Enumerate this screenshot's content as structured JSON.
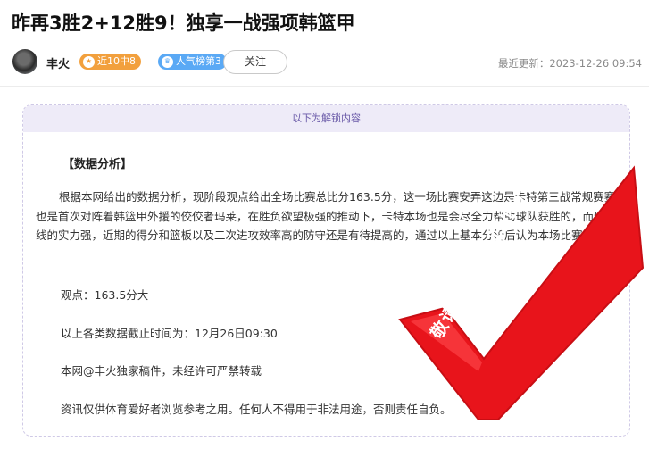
{
  "article": {
    "title": "昨再3胜2+12胜9！独享一战强项韩篮甲"
  },
  "meta": {
    "author": "丰火",
    "badge_streak": "近10中8",
    "badge_rank": "人气榜第3",
    "follow_label": "关注",
    "update_time": "最近更新：2023-12-26 09:54"
  },
  "content": {
    "unlock_header": "以下为解锁内容",
    "section_title": "【数据分析】",
    "paragraph": "根据本网给出的数据分析，现阶段观点给出全场比赛总比分163.5分，这一场比赛安弄这边是卡特第三战常规赛赛事，也是首次对阵着韩篮甲外援的佼佼者玛莱，在胜负欲望极强的推动下，卡特本场也是会尽全力帮助球队获胜的，而玛莱在内线的实力强，近期的得分和篮板以及二次进攻效率高的防守还是有待提高的，通过以上基本分析后认为本场比赛大比分。",
    "view": "观点：163.5分大",
    "deadline": "以上各类数据截止时间为：12月26日09:30",
    "copyright": "本网@丰火独家稿件，未经许可严禁转载",
    "disclaimer": "资讯仅供体育爱好者浏览参考之用。任何人不得用于非法用途，否则责任自负。"
  },
  "watermark": {
    "text": "敬请关注前瞻职业分析师",
    "color": "#e8141b"
  },
  "icons": {
    "streak_badge_icon": "star-icon",
    "rank_badge_icon": "crown-icon"
  }
}
